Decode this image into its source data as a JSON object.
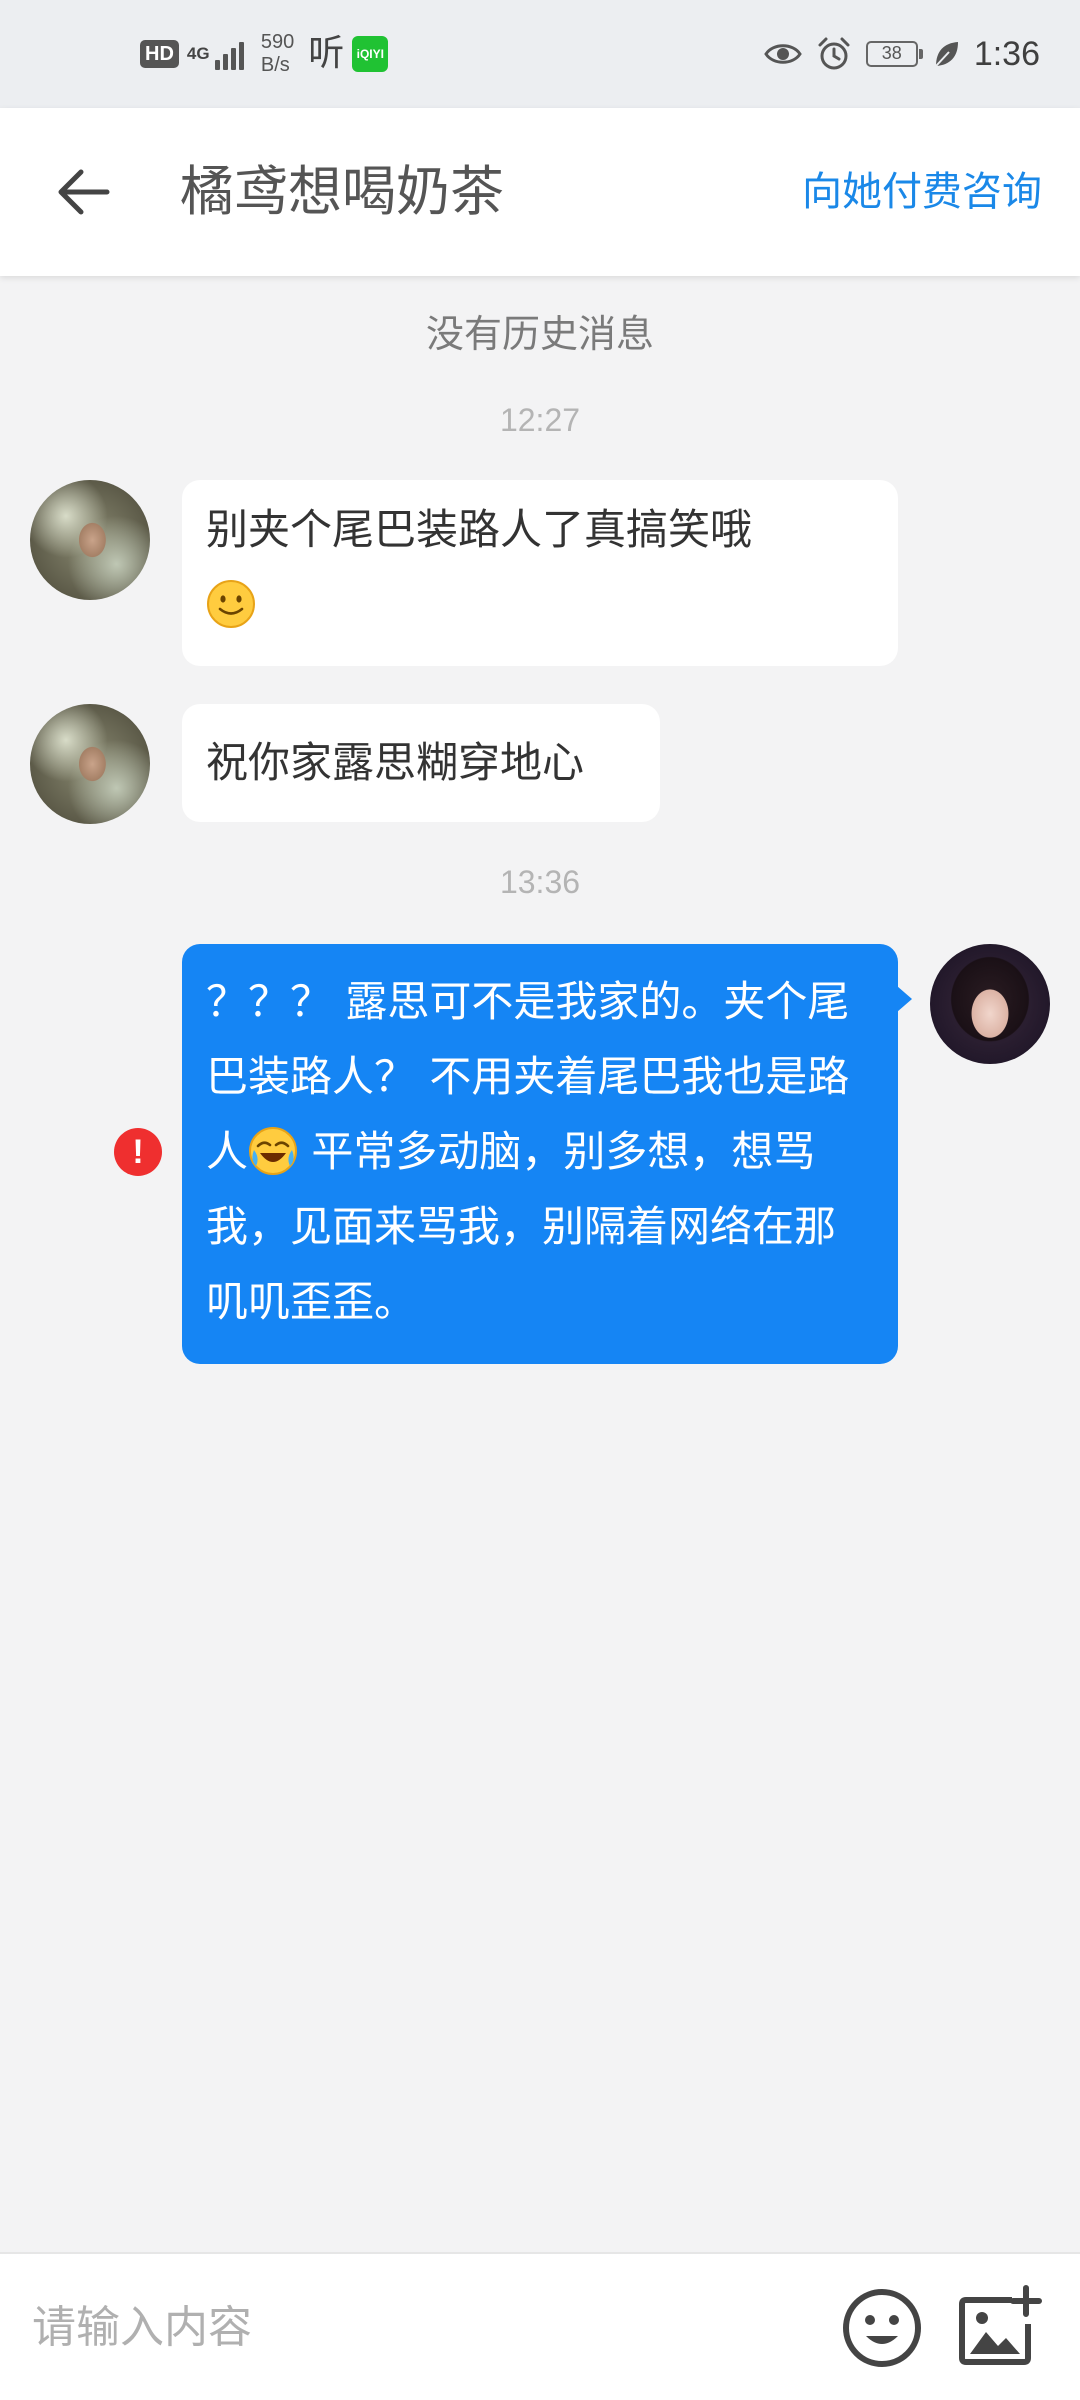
{
  "status_bar": {
    "hd": "HD",
    "network": "4G",
    "speed_value": "590",
    "speed_unit": "B/s",
    "ting_app": "听",
    "iqiyi_label": "iQIYI",
    "battery": "38",
    "time": "1:36"
  },
  "header": {
    "title": "橘鸢想喝奶茶",
    "action": "向她付费咨询"
  },
  "chat": {
    "no_history": "没有历史消息",
    "messages": [
      {
        "time": "12:27",
        "text": "别夹个尾巴装路人了真搞笑哦"
      },
      {
        "text": "祝你家露思糊穿地心"
      },
      {
        "time": "13:36",
        "text_part1": "？？？ 露思可不是我家的。夹个尾巴装路人？ 不用夹着尾巴我也是路人",
        "text_part2": " 平常多动脑，别多想，想骂我，见面来骂我，别隔着网络在那叽叽歪歪。",
        "status": "send_failed"
      }
    ]
  },
  "input": {
    "placeholder": "请输入内容"
  },
  "icons": {
    "back": "back-arrow-icon",
    "emoji_button": "emoji-smile-icon",
    "image_button": "image-add-icon",
    "error": "error-icon",
    "slightly_smiling_emoji": "slightly-smiling-emoji",
    "laughing_crying_emoji": "laughing-crying-emoji"
  },
  "colors": {
    "accent": "#1a88e8",
    "outgoing_bubble": "#1585f4",
    "error": "#ef2f2f",
    "background": "#f3f3f4"
  }
}
